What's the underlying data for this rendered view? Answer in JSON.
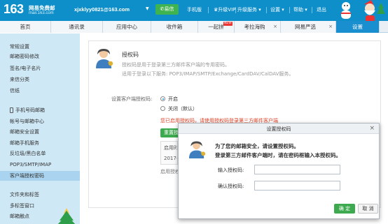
{
  "header": {
    "logo_number": "163",
    "logo_title": "网易免费邮",
    "logo_domain": "mail.163.com",
    "user_email": "xjxklyy0821@163.com",
    "yixin_label": "易信",
    "links": [
      "手机版",
      "升级VIP",
      "升级服务",
      "设置",
      "帮助",
      "退出"
    ]
  },
  "tabs": [
    "首页",
    "通讯录",
    "应用中心",
    "收件箱",
    "一起拼",
    "考拉海购",
    "网易严选",
    "设置"
  ],
  "new_badge": "NEW",
  "sidebar": {
    "items": [
      "常规设置",
      "邮箱密码修改",
      "签名/电子名片",
      "来信分类",
      "信纸",
      "手机号码邮箱",
      "帐号与邮箱中心",
      "邮箱安全设置",
      "邮箱手机服务",
      "反垃圾/黑白名单",
      "POP3/SMTP/IMAP",
      "客户端授权密码",
      "文件夹和标签",
      "多标签窗口",
      "邮箱触点"
    ],
    "active_index": 11
  },
  "main": {
    "title": "授权码",
    "desc1": "授权码是用于登录第三方邮件客户端的专用密码。",
    "desc2": "适用于登录以下服务: POP3/IMAP/SMTP/Exchange/CardDAV/CalDAV服务。",
    "field_label": "设置客户端授权码:",
    "option_on": "开启",
    "option_off": "关闭（默认）",
    "warning": "您已启用授权码，请使用授权码登录第三方邮件客户端",
    "reset_button": "重置授权码",
    "table_header": "启用时间",
    "table_value": "2017-",
    "used_text": "启用授权码"
  },
  "dialog": {
    "title": "设置授权码",
    "line1": "为了您的邮箱安全，请设置授权码。",
    "line2": "登录第三方邮件客户端时，请在密码框输入本授权码。",
    "label1": "输入授权码:",
    "label2": "确认授权码:",
    "input1_value": "",
    "input2_value": "",
    "ok": "确 定",
    "cancel": "取 消"
  },
  "colors": {
    "topbar": "#0e8fc9",
    "active_tab": "#1a8fd0",
    "sidebar": "#cfe8f6",
    "sidebar_active": "#a9d3ee",
    "ok_button": "#3eaa4f",
    "warning": "#e0452a"
  }
}
